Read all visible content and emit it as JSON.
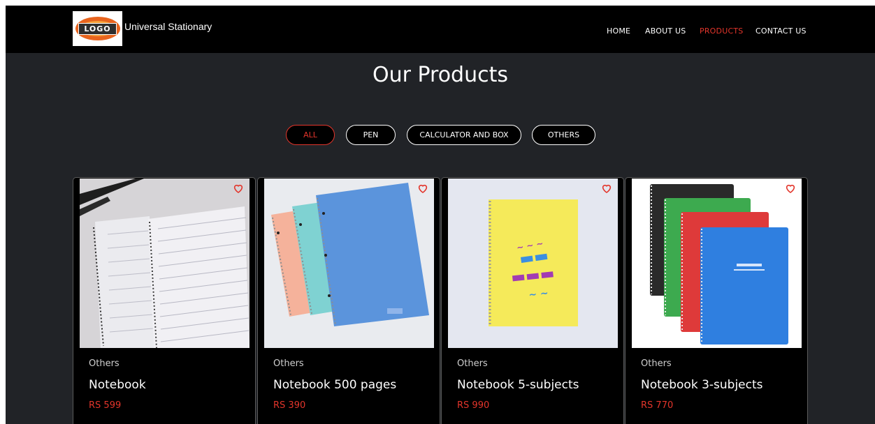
{
  "header": {
    "logo_text": "LOGO",
    "brand": "Universal Stationary",
    "nav": [
      "HOME",
      "ABOUT US",
      "PRODUCTS",
      "CONTACT US"
    ],
    "active_nav": "PRODUCTS"
  },
  "title": "Our Products",
  "filters": [
    "ALL",
    "PEN",
    "CALCULATOR AND BOX",
    "OTHERS"
  ],
  "active_filter": "ALL",
  "products": [
    {
      "category": "Others",
      "name": "Notebook",
      "price": "RS 599"
    },
    {
      "category": "Others",
      "name": "Notebook 500 pages",
      "price": "RS 390"
    },
    {
      "category": "Others",
      "name": "Notebook 5-subjects",
      "price": "RS 990"
    },
    {
      "category": "Others",
      "name": "Notebook 3-subjects",
      "price": "RS 770"
    }
  ],
  "colors": {
    "accent": "#e3352b",
    "background": "#212327",
    "header": "#000000"
  },
  "icons": {
    "favorite": "heart-icon"
  }
}
